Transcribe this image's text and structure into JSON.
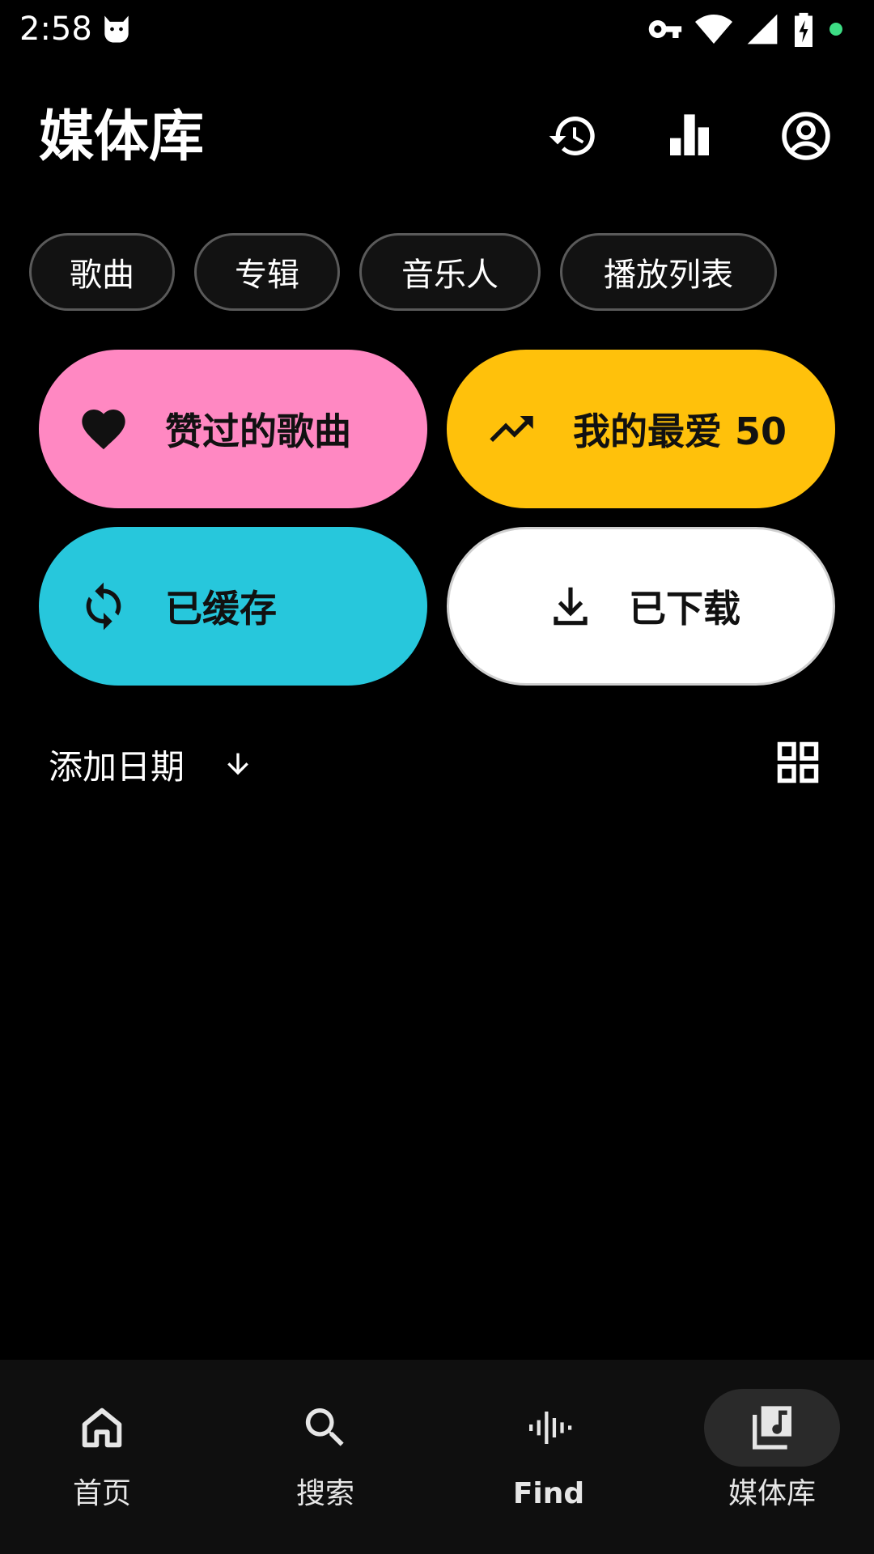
{
  "status_bar": {
    "time": "2:58",
    "icons": [
      "cat-notification-icon",
      "vpn-key-icon",
      "wifi-icon",
      "signal-icon",
      "battery-charging-icon",
      "privacy-dot-icon"
    ],
    "privacy_dot_color": "#3ddc84"
  },
  "header": {
    "title": "媒体库",
    "actions": [
      "history-icon",
      "stats-icon",
      "account-icon"
    ]
  },
  "chips": [
    {
      "label": "歌曲"
    },
    {
      "label": "专辑"
    },
    {
      "label": "音乐人"
    },
    {
      "label": "播放列表"
    }
  ],
  "cards": {
    "liked": {
      "label": "赞过的歌曲",
      "icon": "heart-icon",
      "color": "#ff88c2"
    },
    "top50": {
      "label": "我的最爱 50",
      "icon": "trending-up-icon",
      "color": "#ffc10b"
    },
    "cached": {
      "label": "已缓存",
      "icon": "sync-icon",
      "color": "#27c7dc"
    },
    "downloaded": {
      "label": "已下载",
      "icon": "download-icon",
      "color": "#ffffff"
    }
  },
  "sort": {
    "label": "添加日期",
    "direction_icon": "arrow-down-icon",
    "view_icon": "grid-view-icon"
  },
  "bottom_nav": {
    "items": [
      {
        "label": "首页",
        "icon": "home-icon"
      },
      {
        "label": "搜索",
        "icon": "search-icon"
      },
      {
        "label": "Find",
        "icon": "audio-waveform-icon"
      },
      {
        "label": "媒体库",
        "icon": "library-music-icon"
      }
    ],
    "active": "媒体库"
  }
}
